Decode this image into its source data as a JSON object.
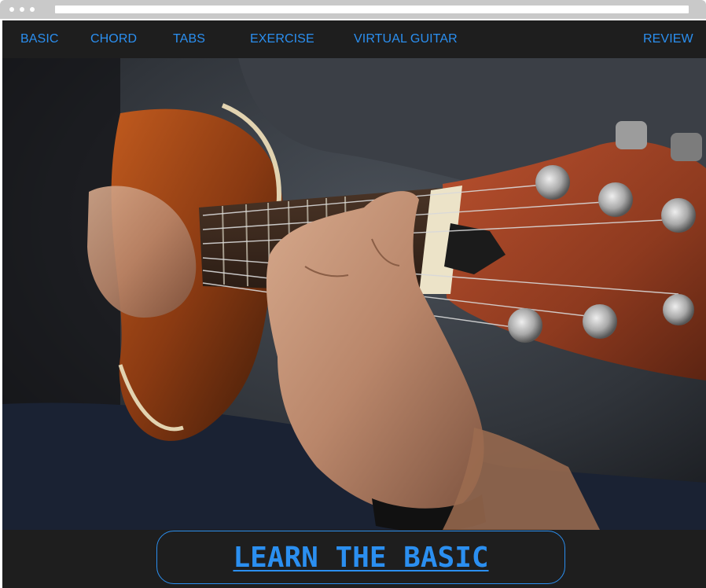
{
  "nav": {
    "items": [
      {
        "label": "BASIC"
      },
      {
        "label": "CHORD"
      },
      {
        "label": "TABS"
      },
      {
        "label": "EXERCISE"
      },
      {
        "label": "VIRTUAL GUITAR"
      },
      {
        "label": "REVIEW"
      }
    ]
  },
  "cta": {
    "label": "LEARN THE BASIC"
  },
  "colors": {
    "accent": "#2b8ff0",
    "background": "#1e1e1e",
    "titlebar": "#c9c9c9"
  }
}
